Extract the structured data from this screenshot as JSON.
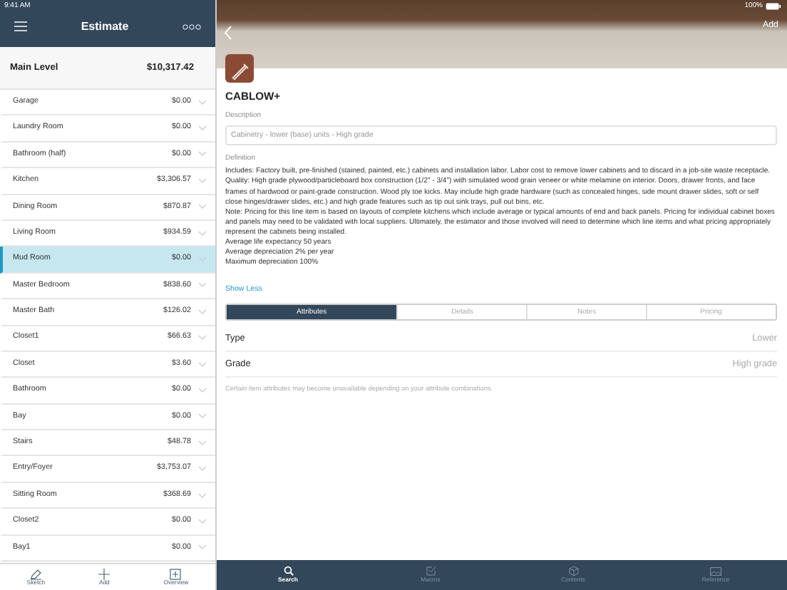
{
  "status_bar": {
    "time": "9:41 AM",
    "battery": "100%"
  },
  "sidebar": {
    "title": "Estimate",
    "level": {
      "name": "Main Level",
      "total": "$10,317.42"
    },
    "rooms": [
      {
        "name": "Garage",
        "amount": "$0.00",
        "selected": false
      },
      {
        "name": "Laundry Room",
        "amount": "$0.00",
        "selected": false
      },
      {
        "name": "Bathroom (half)",
        "amount": "$0.00",
        "selected": false
      },
      {
        "name": "Kitchen",
        "amount": "$3,306.57",
        "selected": false
      },
      {
        "name": "Dining Room",
        "amount": "$870.87",
        "selected": false
      },
      {
        "name": "Living Room",
        "amount": "$934.59",
        "selected": false
      },
      {
        "name": "Mud Room",
        "amount": "$0.00",
        "selected": true
      },
      {
        "name": "Master Bedroom",
        "amount": "$838.60",
        "selected": false
      },
      {
        "name": "Master Bath",
        "amount": "$126.02",
        "selected": false
      },
      {
        "name": "Closet1",
        "amount": "$66.63",
        "selected": false
      },
      {
        "name": "Closet",
        "amount": "$3.60",
        "selected": false
      },
      {
        "name": "Bathroom",
        "amount": "$0.00",
        "selected": false
      },
      {
        "name": "Bay",
        "amount": "$0.00",
        "selected": false
      },
      {
        "name": "Stairs",
        "amount": "$48.78",
        "selected": false
      },
      {
        "name": "Entry/Foyer",
        "amount": "$3,753.07",
        "selected": false
      },
      {
        "name": "Sitting Room",
        "amount": "$368.69",
        "selected": false
      },
      {
        "name": "Closet2",
        "amount": "$0.00",
        "selected": false
      },
      {
        "name": "Bay1",
        "amount": "$0.00",
        "selected": false
      }
    ],
    "toolbar": [
      {
        "label": "Sketch",
        "kind": "pencil"
      },
      {
        "label": "Add",
        "kind": "plus"
      },
      {
        "label": "Overview",
        "kind": "overview"
      }
    ]
  },
  "detail": {
    "header_action": "Add",
    "code": "CABLOW+",
    "description_label": "Description",
    "description": "Cabinetry - lower (base) units - High grade",
    "definition_label": "Definition",
    "definition": [
      "Includes: Factory built, pre-finished (stained, painted, etc.) cabinets and installation labor.  Labor cost to remove lower cabinets and to discard in a job-site waste receptacle.",
      "Quality: High grade plywood/particleboard box construction (1/2\" - 3/4\") with simulated wood grain veneer or white melamine on interior.  Doors, drawer fronts, and face frames of hardwood or paint-grade construction.  Wood ply toe kicks.  May include high grade hardware (such as concealed hinges, side mount drawer slides, soft or self close hinges/drawer slides, etc.) and high grade features such as tip out sink trays, pull out bins, etc.",
      "Note: Pricing for this line item is based on layouts of complete kitchens which include average or typical amounts of end and back panels.  Pricing for individual cabinet boxes and panels may need to be validated with local suppliers.  Ultimately, the estimator and those involved will need to determine which line items and what pricing appropriately represent the cabinets being installed.",
      "Average life expectancy 50 years",
      "Average depreciation 2% per year",
      "Maximum depreciation 100%"
    ],
    "toggle_link": "Show Less",
    "tabs": [
      {
        "label": "Attributes",
        "selected": true
      },
      {
        "label": "Details",
        "selected": false
      },
      {
        "label": "Notes",
        "selected": false
      },
      {
        "label": "Pricing",
        "selected": false
      }
    ],
    "attributes": [
      {
        "name": "Type",
        "value": "Lower"
      },
      {
        "name": "Grade",
        "value": "High grade"
      }
    ],
    "note": "Certain item attributes may become unavailable depending on your attribute combinations."
  },
  "tab_bar": [
    {
      "label": "Search",
      "kind": "search",
      "selected": true
    },
    {
      "label": "Macros",
      "kind": "check",
      "selected": false
    },
    {
      "label": "Contents",
      "kind": "box",
      "selected": false
    },
    {
      "label": "Reference",
      "kind": "image",
      "selected": false
    }
  ]
}
